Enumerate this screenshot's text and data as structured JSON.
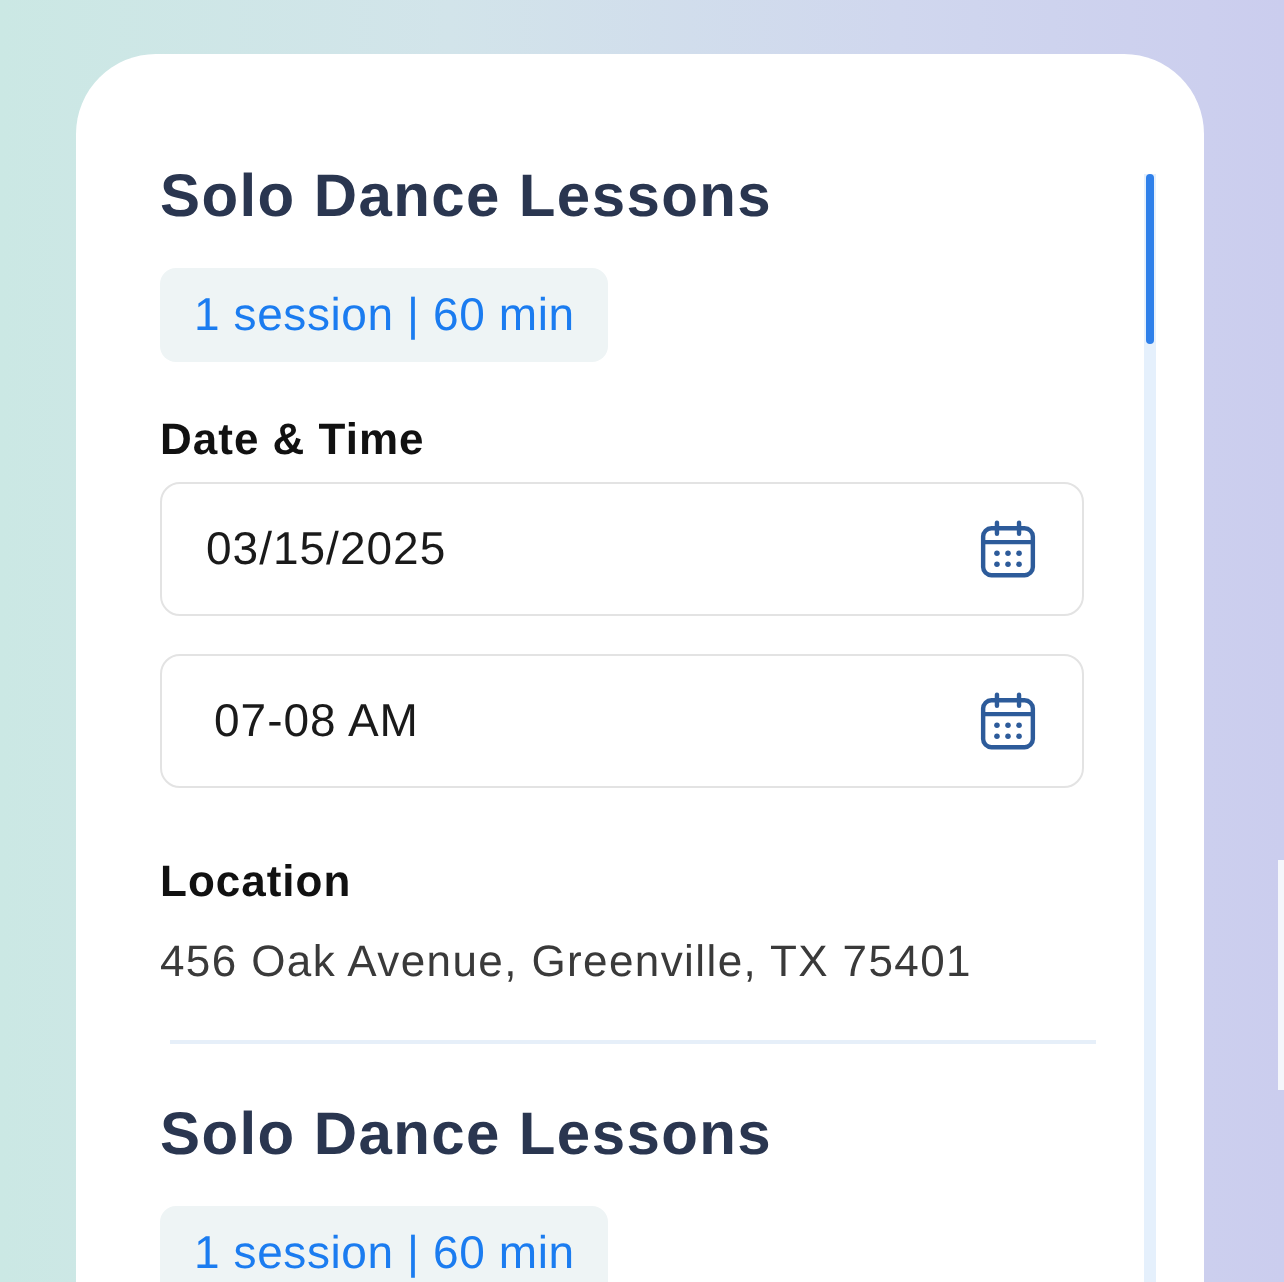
{
  "sessions": [
    {
      "title": "Solo Dance Lessons",
      "badge": "1 session | 60 min",
      "date_time": {
        "label": "Date & Time",
        "fields": [
          {
            "kind": "date",
            "value": "03/15/2025"
          },
          {
            "kind": "time",
            "value": "07-08 AM"
          }
        ]
      },
      "location": {
        "label": "Location",
        "address": "456 Oak Avenue, Greenville, TX 75401"
      }
    },
    {
      "title": "Solo Dance Lessons",
      "badge": "1 session | 60 min"
    }
  ]
}
